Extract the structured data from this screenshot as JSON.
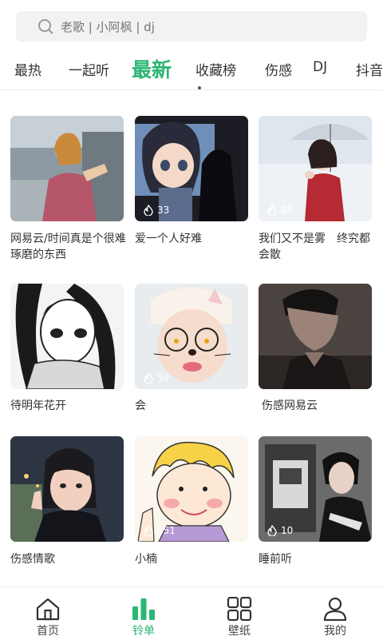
{
  "search": {
    "placeholder": "老歌 | 小阿枫 | dj"
  },
  "tabs": [
    "最热",
    "一起听",
    "最新",
    "收藏榜",
    "伤感",
    "DJ",
    "抖音"
  ],
  "active_tab": "最新",
  "cards": [
    {
      "title": "网易云/时间真是个很难琢磨的东西",
      "count": ""
    },
    {
      "title": "爱一个人好难",
      "count": "33"
    },
    {
      "title": "我们又不是雾　终究都会散",
      "count": "85"
    },
    {
      "title": "待明年花开",
      "count": ""
    },
    {
      "title": "会",
      "count": "59"
    },
    {
      "title": "伤感网易云",
      "count": ""
    },
    {
      "title": "伤感情歌",
      "count": ""
    },
    {
      "title": "小楠",
      "count": "151"
    },
    {
      "title": "睡前听",
      "count": "10"
    }
  ],
  "nav": [
    {
      "label": "首页",
      "icon": "home-icon"
    },
    {
      "label": "铃单",
      "icon": "bar-chart-icon"
    },
    {
      "label": "壁纸",
      "icon": "grid-icon"
    },
    {
      "label": "我的",
      "icon": "user-icon"
    }
  ],
  "colors": {
    "accent": "#2bb673"
  }
}
